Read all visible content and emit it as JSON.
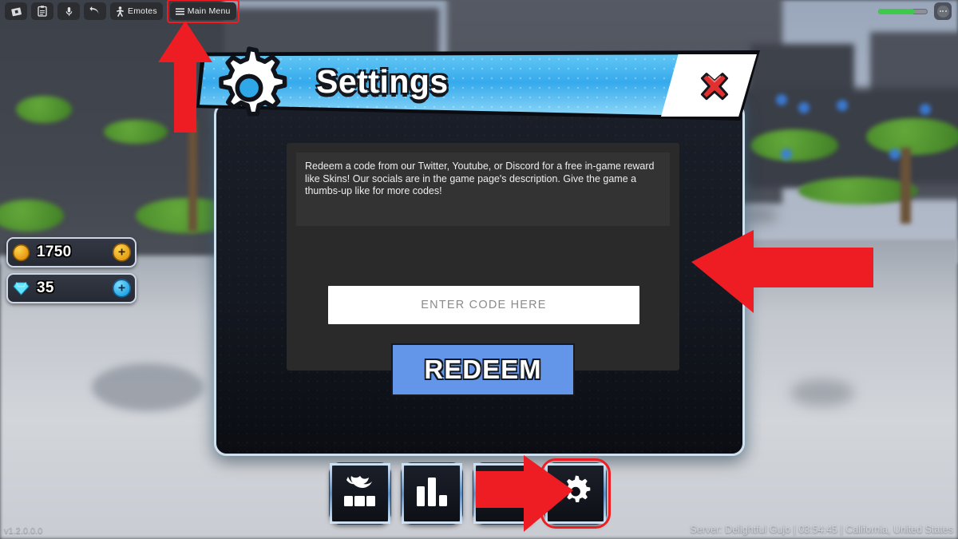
{
  "topbar": {
    "buttons": [
      {
        "name": "roblox-logo",
        "label": "",
        "icon": "roblox-icon"
      },
      {
        "name": "clipboard",
        "label": "",
        "icon": "clipboard-icon"
      },
      {
        "name": "microphone",
        "label": "",
        "icon": "microphone-icon"
      },
      {
        "name": "back",
        "label": "",
        "icon": "back-arrow-icon"
      },
      {
        "name": "emotes",
        "label": "Emotes",
        "icon": "emote-person-icon"
      },
      {
        "name": "main-menu",
        "label": "Main Menu",
        "icon": "hamburger-icon"
      }
    ],
    "emotes_label": "Emotes",
    "main_menu_label": "Main Menu",
    "health_percent": 74
  },
  "currency": [
    {
      "type": "gold",
      "value": "1750",
      "plus": "+",
      "icon": "gold-coin-icon"
    },
    {
      "type": "gem",
      "value": "35",
      "plus": "+",
      "icon": "diamond-gem-icon"
    }
  ],
  "panel": {
    "title": "Settings",
    "gear_icon": "gear-icon",
    "close_icon": "close-x-icon",
    "description": "Redeem a code from our Twitter, Youtube, or Discord for a free in-game reward like Skins! Our socials are in the game page's description. Give the game a thumbs-up like for more codes!",
    "code_placeholder": "ENTER CODE HERE",
    "code_value": "",
    "redeem_label": "REDEEM"
  },
  "bottom_nav": [
    {
      "name": "character-button",
      "icon": "character-icon"
    },
    {
      "name": "stats-button",
      "icon": "bar-chart-icon"
    },
    {
      "name": "shop-button",
      "icon": "obscured-icon"
    },
    {
      "name": "settings-button",
      "icon": "gear-icon",
      "highlighted": true
    }
  ],
  "annotations": [
    {
      "name": "arrow-up-main-menu",
      "direction": "up",
      "color": "#ef1d22"
    },
    {
      "name": "arrow-left-code-input",
      "direction": "left",
      "color": "#ef1d22"
    },
    {
      "name": "arrow-right-settings-button",
      "direction": "right",
      "color": "#ef1d22"
    }
  ],
  "footer": {
    "version": "v1.2.0.0.0",
    "server": "Server: Delightful Gujo | 03:54:45 | California, United States"
  },
  "colors": {
    "accent_blue": "#35aaec",
    "redeem_blue": "#6395e8",
    "annotation_red": "#ef1d22",
    "panel_dark": "#141820",
    "inner_dark": "#2a2a2a"
  }
}
